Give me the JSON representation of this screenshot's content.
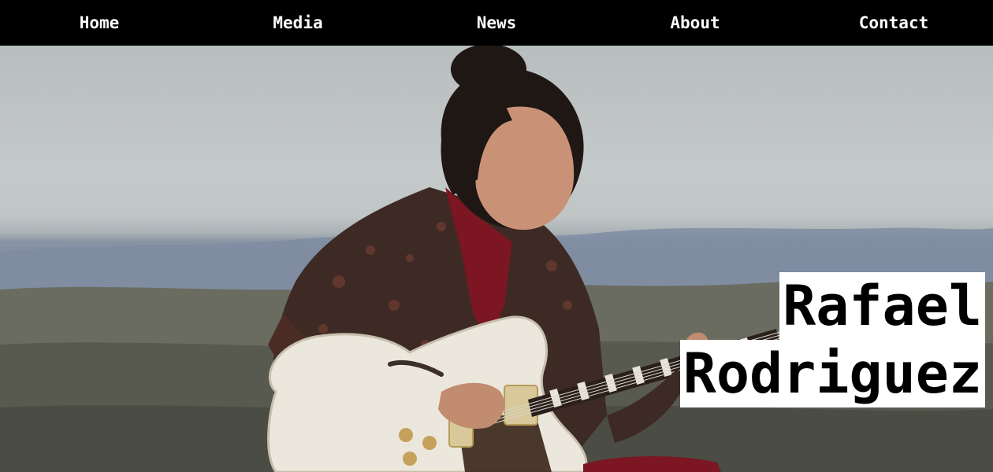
{
  "nav": {
    "items": [
      {
        "label": "Home"
      },
      {
        "label": "Media"
      },
      {
        "label": "News"
      },
      {
        "label": "About"
      },
      {
        "label": "Contact"
      }
    ]
  },
  "hero": {
    "image_subject": "guitarist-photo",
    "name_line_1": "Rafael",
    "name_line_2": "Rodriguez"
  },
  "colors": {
    "nav_background": "#000000",
    "nav_text": "#ffffff",
    "name_background": "#ffffff",
    "name_text": "#000000"
  }
}
